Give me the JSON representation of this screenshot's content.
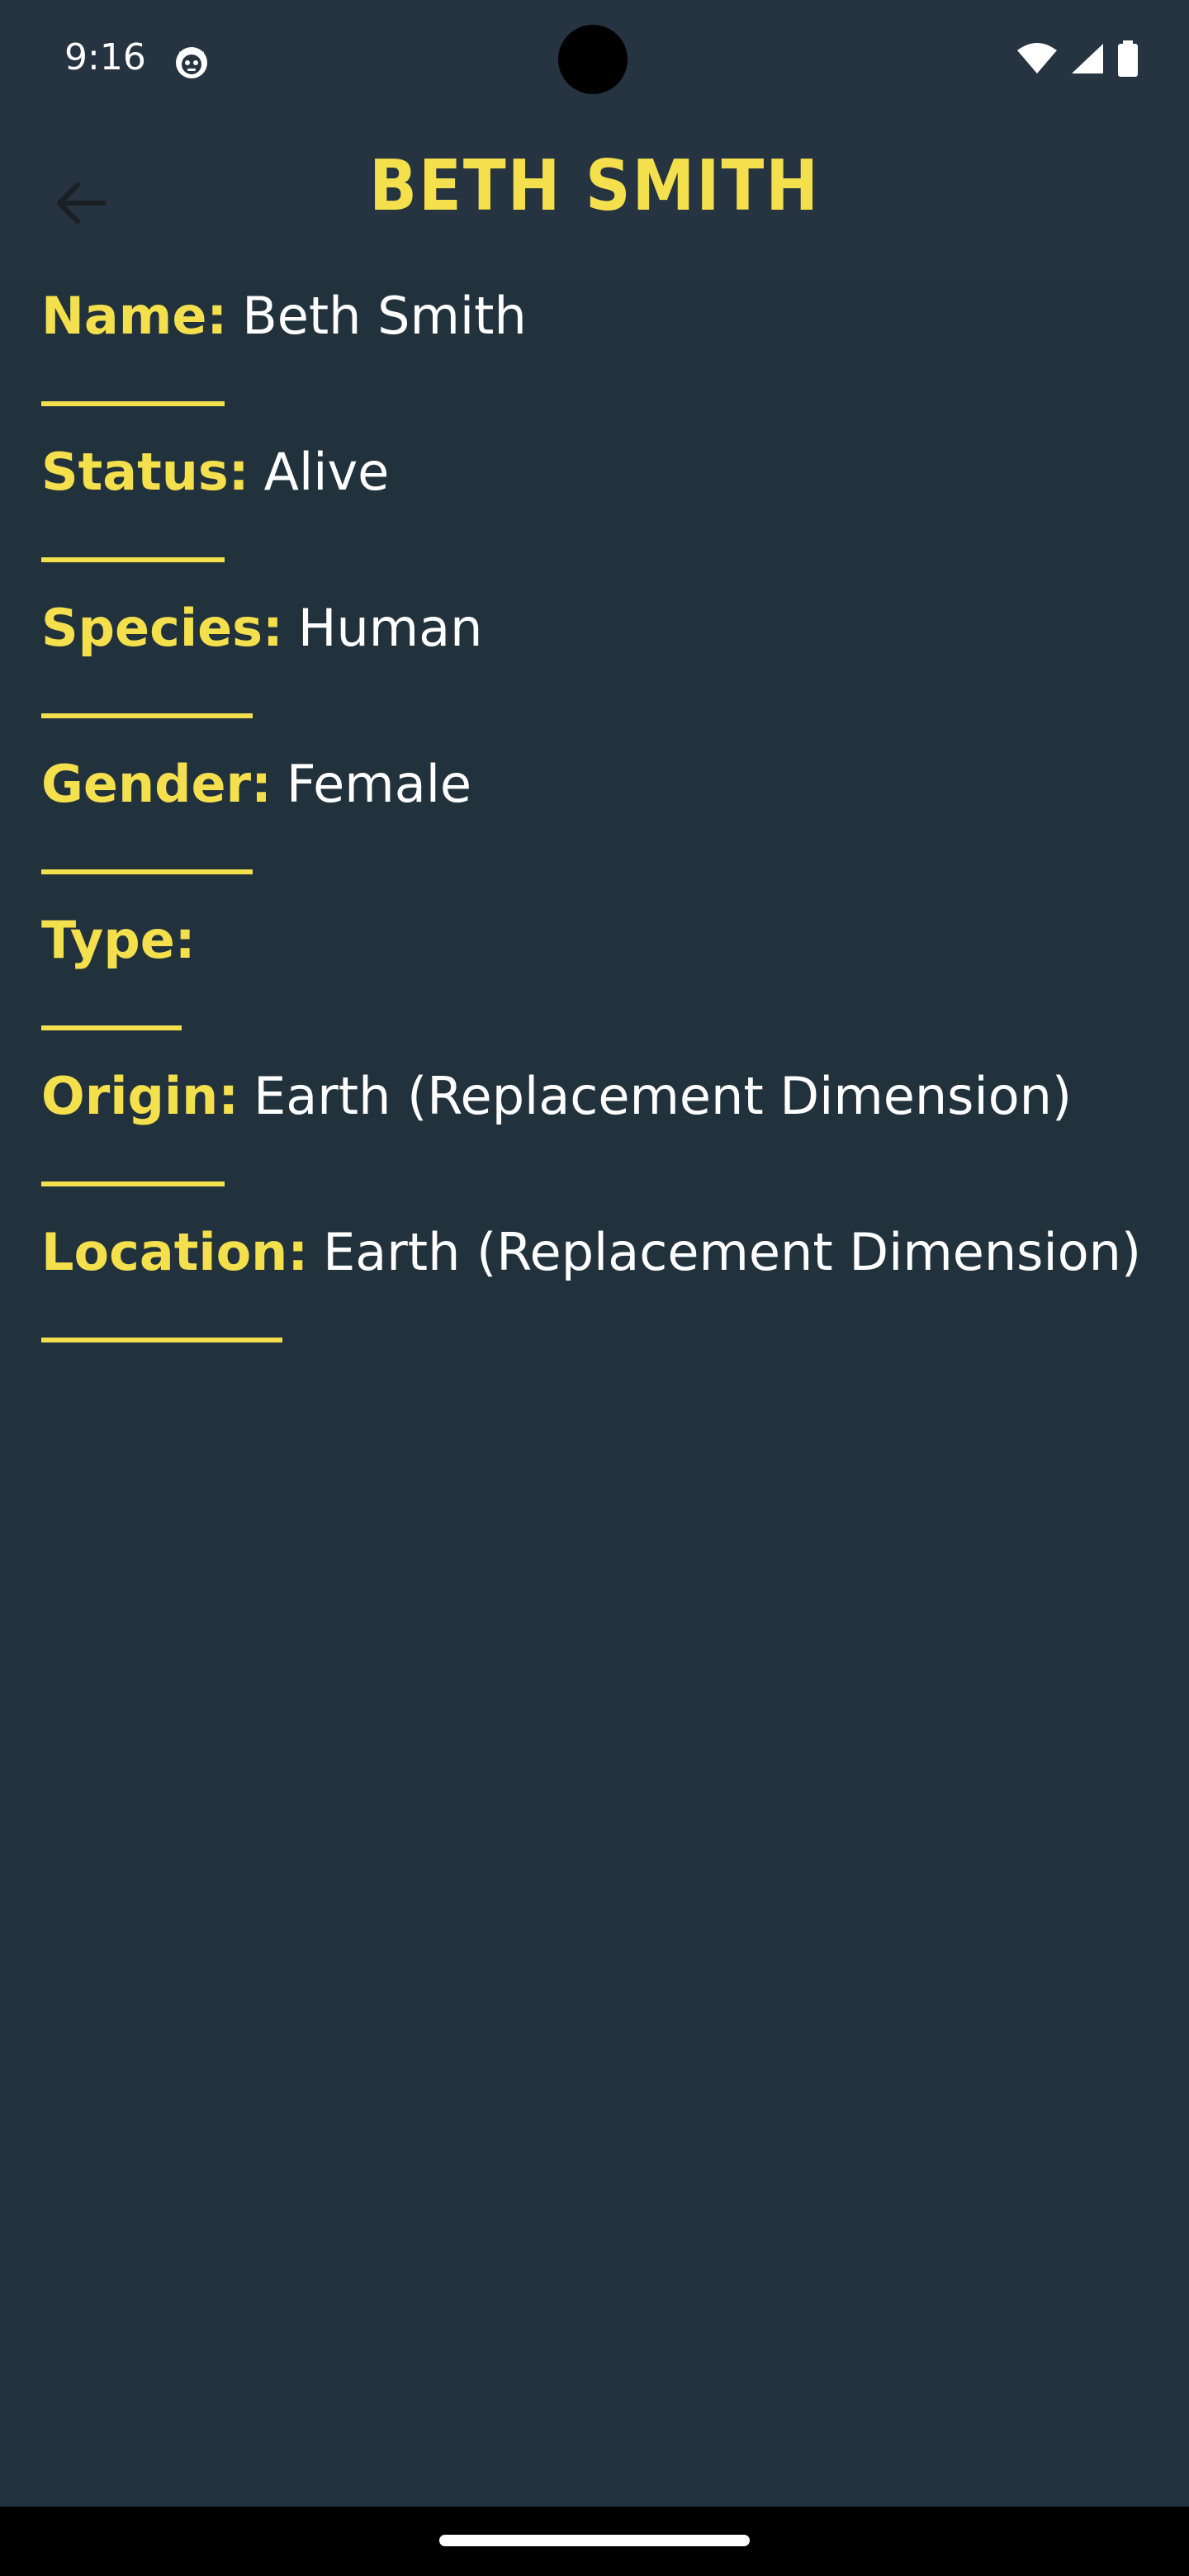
{
  "status_bar": {
    "time": "9:16",
    "app_icon": "cat-face-icon",
    "icons": [
      "wifi-icon",
      "signal-icon",
      "battery-icon"
    ]
  },
  "app_bar": {
    "title": "BETH SMITH",
    "back_icon": "arrow-left-icon"
  },
  "colors": {
    "background": "#22323c",
    "app_bar": "#263340",
    "accent": "#f4df4d",
    "text": "#ffffff"
  },
  "details": [
    {
      "label": "Name:",
      "value": "Beth Smith"
    },
    {
      "label": "Status:",
      "value": "Alive"
    },
    {
      "label": "Species:",
      "value": "Human"
    },
    {
      "label": "Gender:",
      "value": "Female"
    },
    {
      "label": "Type:",
      "value": ""
    },
    {
      "label": "Origin:",
      "value": "Earth (Replacement Dimension)"
    },
    {
      "label": "Location:",
      "value": "Earth (Replacement Dimension)"
    }
  ]
}
